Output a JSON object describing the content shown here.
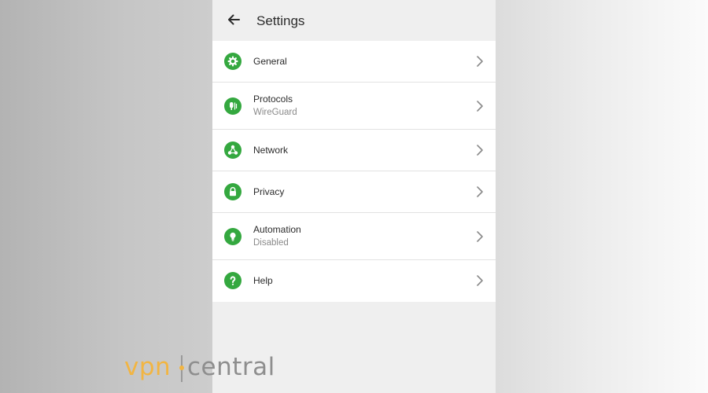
{
  "appbar": {
    "title": "Settings",
    "back_icon": "arrow-left-icon"
  },
  "settings": {
    "items": [
      {
        "label": "General",
        "sublabel": "",
        "icon": "gear-icon"
      },
      {
        "label": "Protocols",
        "sublabel": "WireGuard",
        "icon": "protocol-icon"
      },
      {
        "label": "Network",
        "sublabel": "",
        "icon": "network-icon"
      },
      {
        "label": "Privacy",
        "sublabel": "",
        "icon": "lock-icon"
      },
      {
        "label": "Automation",
        "sublabel": "Disabled",
        "icon": "lightbulb-icon"
      },
      {
        "label": "Help",
        "sublabel": "",
        "icon": "question-icon"
      }
    ]
  },
  "colors": {
    "accent": "#34a83f",
    "chevron": "#8a8a8a"
  },
  "watermark": {
    "part1": "vpn",
    "part2": "central"
  }
}
